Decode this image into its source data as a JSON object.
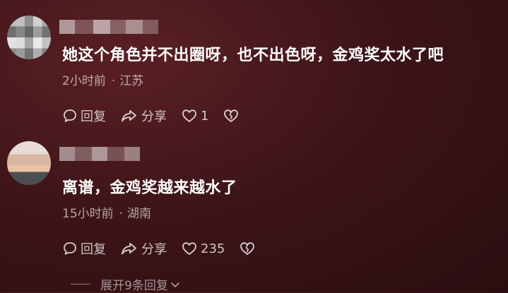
{
  "comments": [
    {
      "text": "她这个角色并不出圈呀，也不出色呀，金鸡奖太水了吧",
      "time": "2小时前",
      "location": "江苏",
      "reply_label": "回复",
      "share_label": "分享",
      "like_count": "1"
    },
    {
      "text": "离谱，金鸡奖越来越水了",
      "time": "15小时前",
      "location": "湖南",
      "reply_label": "回复",
      "share_label": "分享",
      "like_count": "235"
    }
  ],
  "meta_separator": "·",
  "expand_label": "展开9条回复",
  "icons": {
    "reply": "speech-bubble-icon",
    "share": "share-arrow-icon",
    "like": "heart-outline-icon",
    "dislike": "broken-heart-icon",
    "expand": "chevron-down-icon"
  },
  "colors": {
    "background": "#3e1519",
    "text": "#ffffff",
    "meta_text": "#b89c9e"
  }
}
